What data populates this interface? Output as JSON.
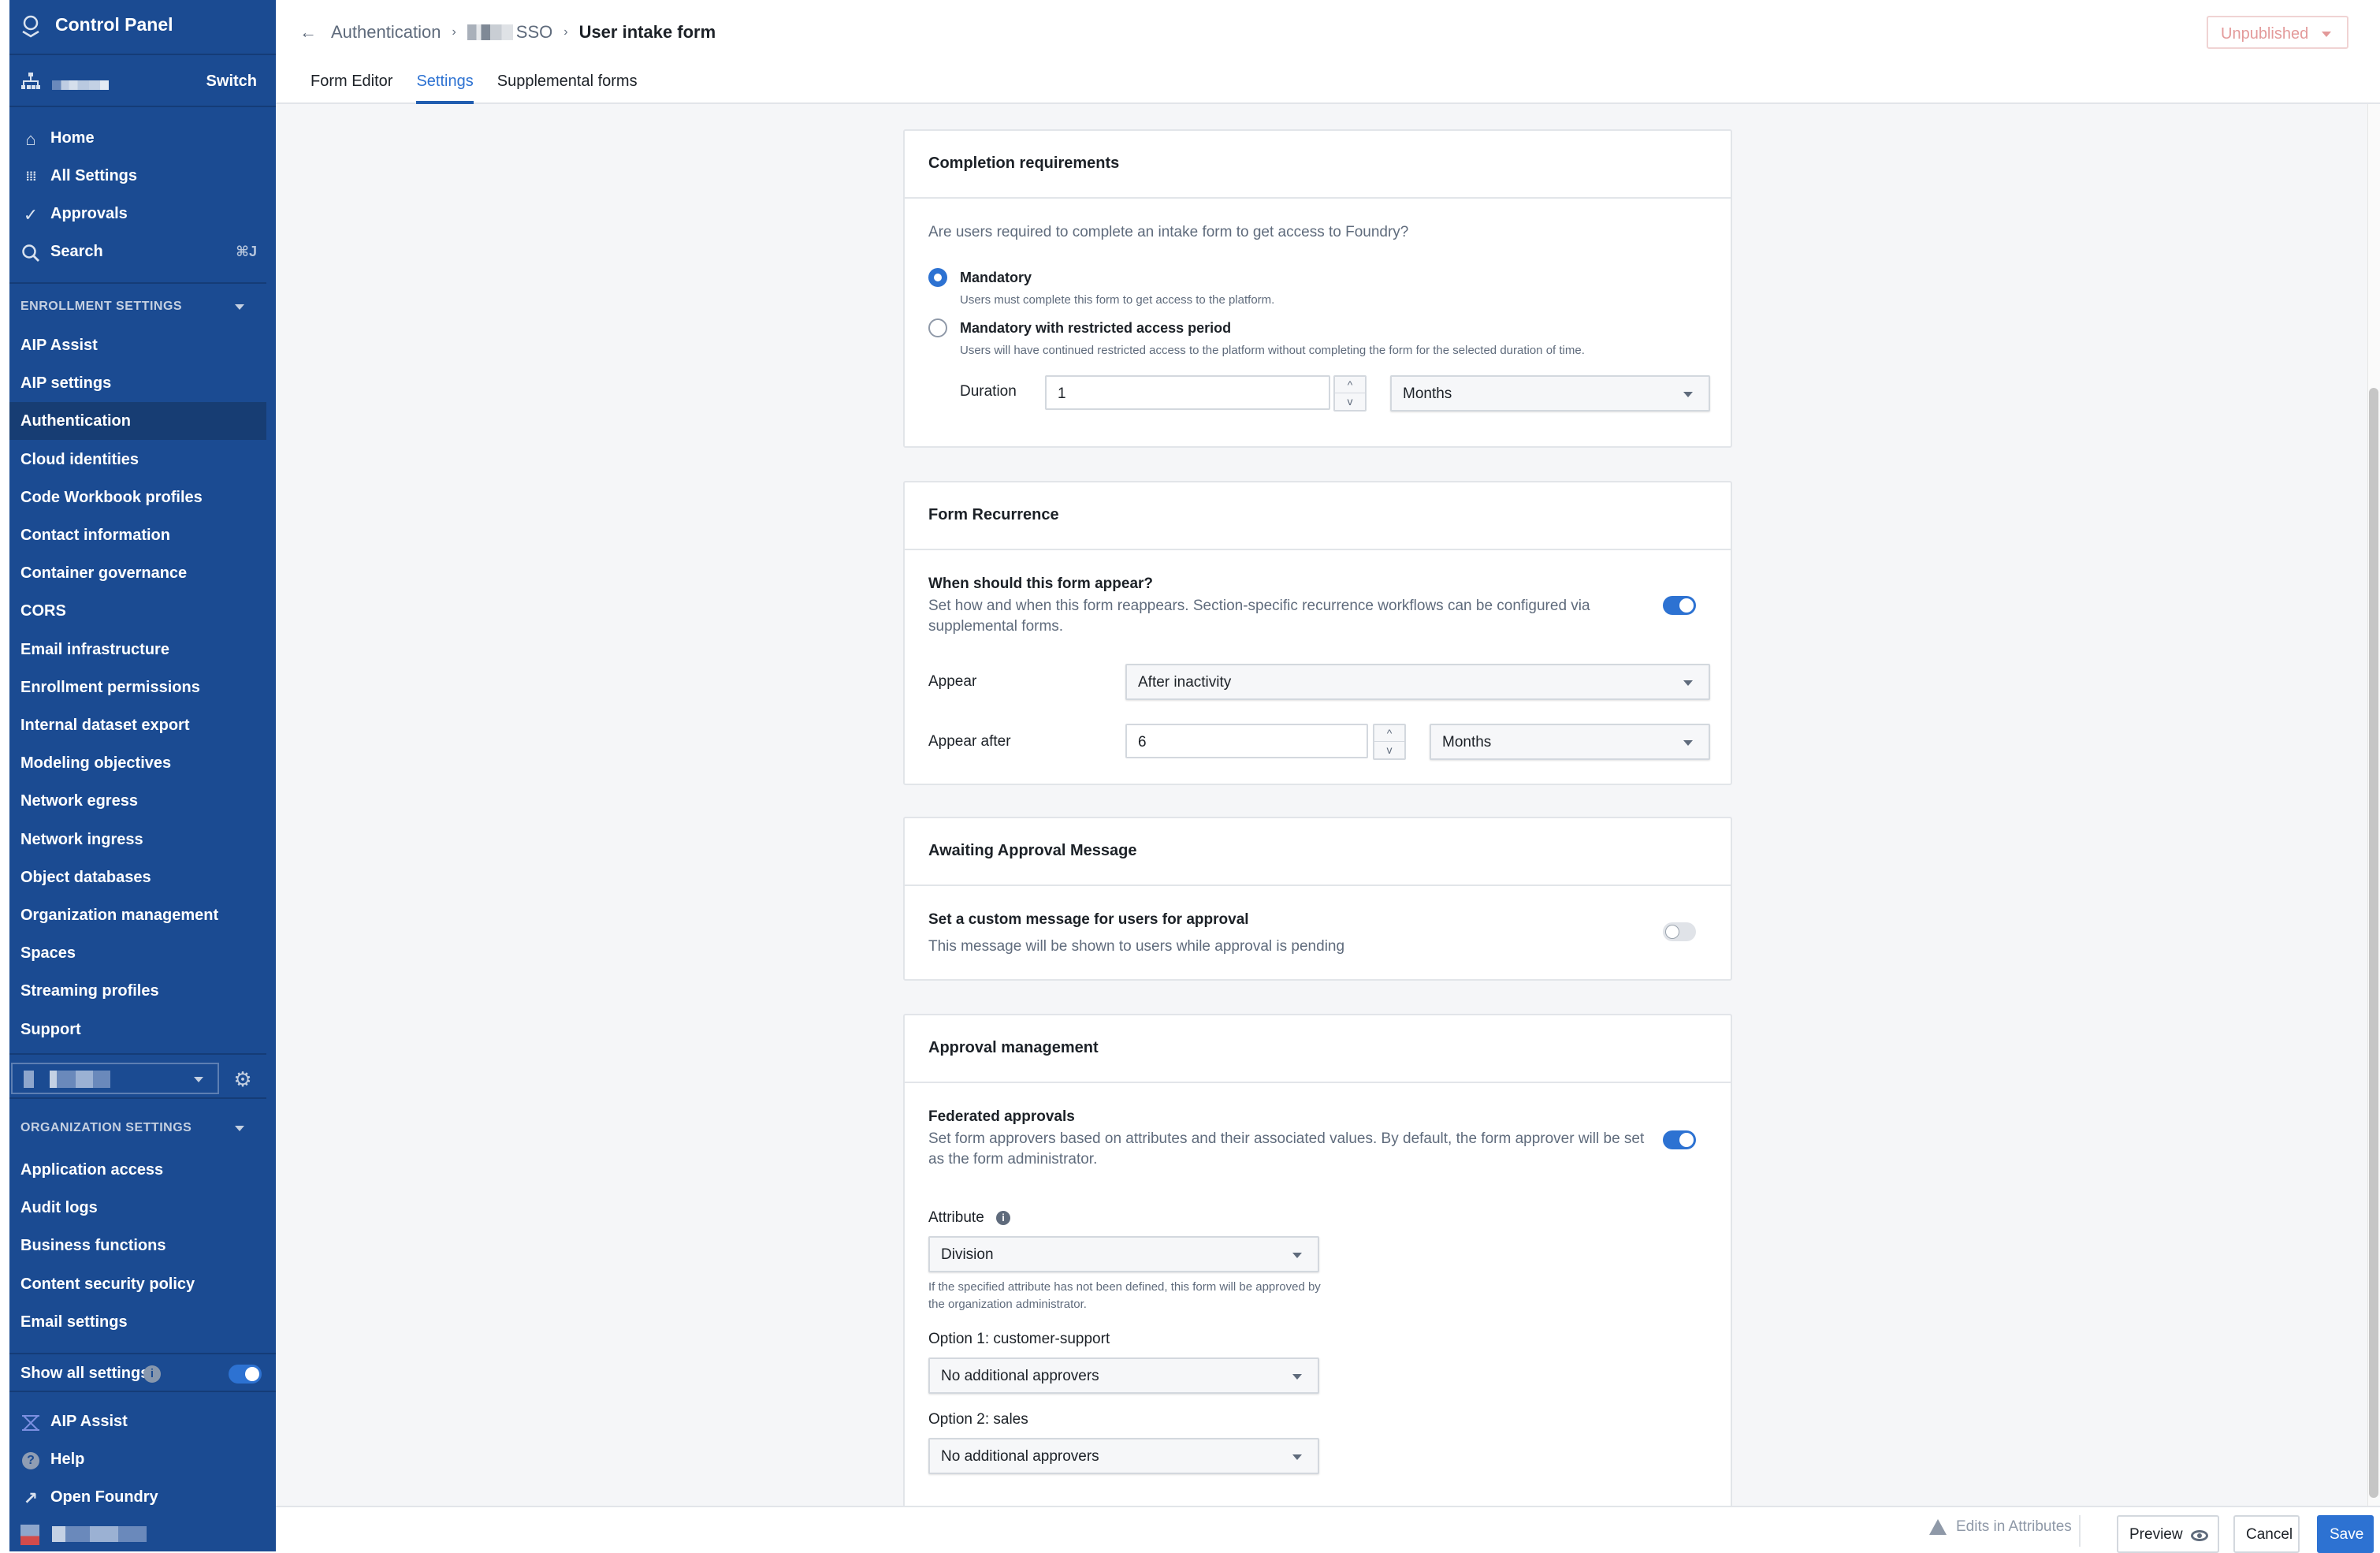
{
  "sidebar": {
    "app_title": "Control Panel",
    "switch_label": "Switch",
    "nav": [
      {
        "label": "Home",
        "icon": "home-icon"
      },
      {
        "label": "All Settings",
        "icon": "grid-icon"
      },
      {
        "label": "Approvals",
        "icon": "check-icon"
      },
      {
        "label": "Search",
        "icon": "search-icon",
        "shortcut": "⌘J"
      }
    ],
    "enrollment_section": {
      "title": "ENROLLMENT SETTINGS",
      "items": [
        {
          "label": "AIP Assist"
        },
        {
          "label": "AIP settings"
        },
        {
          "label": "Authentication",
          "active": true
        },
        {
          "label": "Cloud identities"
        },
        {
          "label": "Code Workbook profiles"
        },
        {
          "label": "Contact information"
        },
        {
          "label": "Container governance"
        },
        {
          "label": "CORS"
        },
        {
          "label": "Email infrastructure"
        },
        {
          "label": "Enrollment permissions"
        },
        {
          "label": "Internal dataset export"
        },
        {
          "label": "Modeling objectives"
        },
        {
          "label": "Network egress"
        },
        {
          "label": "Network ingress"
        },
        {
          "label": "Object databases"
        },
        {
          "label": "Organization management"
        },
        {
          "label": "Spaces"
        },
        {
          "label": "Streaming profiles"
        },
        {
          "label": "Support"
        }
      ]
    },
    "organization_section": {
      "title": "ORGANIZATION SETTINGS",
      "items": [
        {
          "label": "Application access"
        },
        {
          "label": "Audit logs"
        },
        {
          "label": "Business functions"
        },
        {
          "label": "Content security policy"
        },
        {
          "label": "Email settings"
        }
      ]
    },
    "show_all_settings": {
      "label": "Show all settings",
      "enabled": true
    },
    "bottom_nav": [
      {
        "label": "AIP Assist",
        "icon": "aip-assist-icon"
      },
      {
        "label": "Help",
        "icon": "help-icon"
      },
      {
        "label": "Open Foundry",
        "icon": "external-link-icon"
      }
    ]
  },
  "header": {
    "breadcrumb": {
      "root": "Authentication",
      "middle_suffix": "SSO",
      "current": "User intake form"
    },
    "tabs": [
      {
        "label": "Form Editor",
        "active": false
      },
      {
        "label": "Settings",
        "active": true
      },
      {
        "label": "Supplemental forms",
        "active": false
      }
    ],
    "status": "Unpublished"
  },
  "cards": {
    "completion": {
      "title": "Completion requirements",
      "question": "Are users required to complete an intake form to get access to Foundry?",
      "options": [
        {
          "label": "Mandatory",
          "description": "Users must complete this form to get access to the platform.",
          "selected": true
        },
        {
          "label": "Mandatory with restricted access period",
          "description": "Users will have continued restricted access to the platform without completing the form for the selected duration of time.",
          "selected": false
        }
      ],
      "duration_label": "Duration",
      "duration_value": "1",
      "duration_unit": "Months"
    },
    "recurrence": {
      "title": "Form Recurrence",
      "question": "When should this form appear?",
      "description": "Set how and when this form reappears. Section-specific recurrence workflows can be configured via supplemental forms.",
      "enabled": true,
      "appear_label": "Appear",
      "appear_value": "After inactivity",
      "appear_after_label": "Appear after",
      "appear_after_value": "6",
      "appear_after_unit": "Months"
    },
    "awaiting": {
      "title": "Awaiting Approval Message",
      "setting_label": "Set a custom message for users for approval",
      "setting_description": "This message will be shown to users while approval is pending",
      "enabled": false
    },
    "approval": {
      "title": "Approval management",
      "federated_label": "Federated approvals",
      "federated_description": "Set form approvers based on attributes and their associated values. By default, the form approver will be set as the form administrator.",
      "enabled": true,
      "attribute_label": "Attribute",
      "attribute_value": "Division",
      "attribute_help": "If the specified attribute has not been defined, this form will be approved by the organization administrator.",
      "options": [
        {
          "label": "Option 1: customer-support",
          "value": "No additional approvers"
        },
        {
          "label": "Option 2: sales",
          "value": "No additional approvers"
        }
      ]
    }
  },
  "footer": {
    "warning": "Edits in Attributes",
    "preview": "Preview",
    "cancel": "Cancel",
    "save": "Save"
  },
  "colors": {
    "sidebar_bg": "#1b4b92",
    "accent": "#2d72d2",
    "status_text": "#e39a9a"
  }
}
